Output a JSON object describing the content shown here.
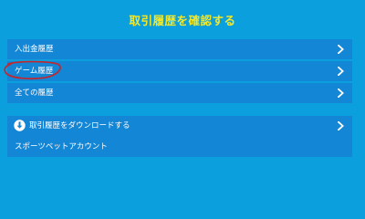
{
  "page": {
    "title": "取引履歴を確認する"
  },
  "menu": {
    "items": [
      {
        "label": "入出金履歴",
        "icon": "chevron-right-icon"
      },
      {
        "label": "ゲーム履歴",
        "icon": "chevron-right-icon"
      },
      {
        "label": "全ての履歴",
        "icon": "chevron-right-icon"
      }
    ]
  },
  "secondary": {
    "download": {
      "label": "取引履歴をダウンロードする",
      "icon": "download-icon",
      "chevron": "chevron-right-icon"
    },
    "account": {
      "label": "スポーツベットアカウント"
    }
  },
  "annotation": {
    "shape": "red-ellipse-circle",
    "target": "ゲーム履歴",
    "color": "#c0282d"
  },
  "colors": {
    "background": "#0c9fde",
    "row": "#1486d6",
    "title": "#f3e827",
    "text": "#ffffff"
  }
}
